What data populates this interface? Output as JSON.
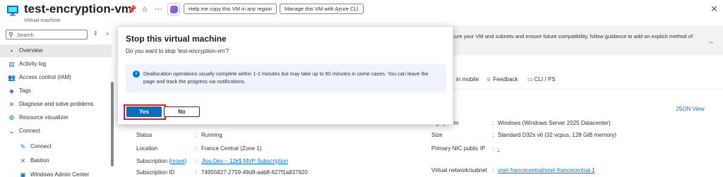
{
  "header": {
    "title": "test-encryption-vm",
    "subtitle": "Virtual machine",
    "copy_region_button": "Help me copy this VM in any region",
    "cli_button": "Manage this VM with Azure CLI"
  },
  "sidebar": {
    "search_placeholder": "Search",
    "items": [
      {
        "label": "Overview",
        "icon": "overview-icon",
        "glyph": "▪",
        "color": "#0078d4",
        "active": true
      },
      {
        "label": "Activity log",
        "icon": "activity-log-icon",
        "glyph": "▤",
        "color": "#0078d4"
      },
      {
        "label": "Access control (IAM)",
        "icon": "people-icon",
        "glyph": "👥",
        "color": "#0078d4"
      },
      {
        "label": "Tags",
        "icon": "tag-icon",
        "glyph": "◆",
        "color": "#8661c5"
      },
      {
        "label": "Diagnose and solve problems",
        "icon": "wrench-icon",
        "glyph": "✕",
        "color": "#0078d4"
      },
      {
        "label": "Resource visualizer",
        "icon": "visualizer-icon",
        "glyph": "⚙",
        "color": "#0078d4"
      },
      {
        "label": "Connect",
        "icon": "chevron-down-icon",
        "glyph": "⌄",
        "color": "#323130"
      },
      {
        "label": "Connect",
        "icon": "connect-icon",
        "glyph": "✎",
        "color": "#0078d4",
        "sub": true
      },
      {
        "label": "Bastion",
        "icon": "bastion-icon",
        "glyph": "✕",
        "color": "#0078d4",
        "sub": true
      },
      {
        "label": "Windows Admin Center",
        "icon": "admin-center-icon",
        "glyph": "▣",
        "color": "#0078d4",
        "sub": true
      }
    ]
  },
  "notice": {
    "text": "ecure your VM and subnets and ensure future compatibility, follow guidance to add an explicit method of"
  },
  "toolbar": {
    "mobile": "in mobile",
    "feedback": "Feedback",
    "cli": "CLI / PS"
  },
  "essentials": {
    "json_view": "JSON View",
    "left": [
      {
        "label": "Status",
        "value": "Running"
      },
      {
        "label": "Location",
        "value": "France Central (Zone 1)"
      },
      {
        "label": "Subscription",
        "label_link": "move",
        "value": "Jlou Dev – 12k$ MVP Subscription",
        "value_is_link": true
      },
      {
        "label": "Subscription ID",
        "value": "74955827-2759-49d8-aab8-627f1a837920"
      }
    ],
    "right": [
      {
        "label": "ing system",
        "value": "Windows (Windows Server 2025 Datacenter)"
      },
      {
        "label": "Size",
        "value": "Standard D32s v6 (32 vcpus, 128 GiB memory)"
      },
      {
        "label": "Primary NIC public IP",
        "value": "-",
        "value_is_link": true
      },
      {
        "label": "Virtual network/subnet",
        "value": "vnet-francecentral/snet-francecentral-1",
        "value_is_link": true
      }
    ],
    "separator": ":"
  },
  "dialog": {
    "title": "Stop this virtual machine",
    "question": "Do you want to stop 'test-encryption-vm'?",
    "info": "Deallocation operations usually complete within 1-2 minutes but may take up to 90 minutes in some cases. You can leave the page and track the progress via notifications.",
    "yes_label": "Yes",
    "no_label": "No"
  }
}
